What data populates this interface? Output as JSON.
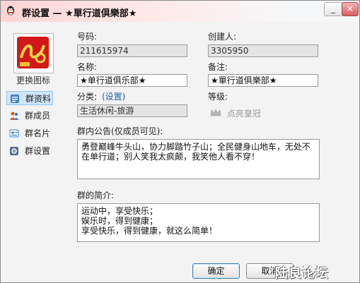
{
  "window": {
    "title": "群设置 — ★單行道俱樂部★",
    "minimize_glyph": "_",
    "close_glyph": "×"
  },
  "sidebar": {
    "change_icon_label": "更换图标",
    "items": [
      {
        "label": "群资料",
        "icon": "info-icon",
        "active": true
      },
      {
        "label": "群成员",
        "icon": "members-icon",
        "active": false
      },
      {
        "label": "群名片",
        "icon": "card-icon",
        "active": false
      },
      {
        "label": "群设置",
        "icon": "settings-icon",
        "active": false
      }
    ]
  },
  "form": {
    "number_label": "号码:",
    "number_value": "211615974",
    "creator_label": "创建人:",
    "creator_value": "3305950",
    "name_label": "名称:",
    "name_value": "★单行道俱乐部★",
    "note_label": "备注:",
    "note_value": "★單行道俱樂部★",
    "category_label": "分类:",
    "category_link": "(设置)",
    "category_value": "生活休闲-旅游",
    "level_label": "等级:",
    "crown_label": "点亮皇冠",
    "announcement_label": "群内公告(仅成员可见):",
    "announcement_text": "勇登巅峰牛头山，协力脚踏竹子山；全民健身山地车，无处不在单行道；别人笑我太疯颠，我笑他人看不穿！",
    "intro_label": "群的简介:",
    "intro_text": "运动中，享受快乐；\n娱乐时，得到健康；\n享受快乐，得到健康，就这么简单！"
  },
  "buttons": {
    "ok": "确定",
    "cancel": "取消"
  },
  "watermark": "陆良论坛",
  "colors": {
    "accent": "#1b5fb4",
    "avatar_bg": "#d21818",
    "active_tab": "#cfe6fb"
  }
}
